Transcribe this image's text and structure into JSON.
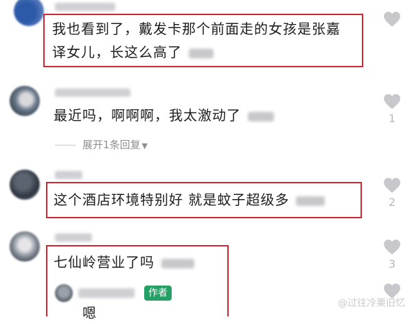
{
  "comments": [
    {
      "text_line1": "我也看到了，戴发卡那个前面走的女孩是张嘉",
      "text_line2": "译女儿，长这么高了",
      "likes": ""
    },
    {
      "text": "最近吗，啊啊啊，我太激动了",
      "likes": "1",
      "expand_label": "展开1条回复"
    },
    {
      "text": "这个酒店环境特别好 就是蚊子超级多",
      "likes": "2"
    },
    {
      "text": "七仙岭营业了吗",
      "likes": "3",
      "reply": {
        "badge": "作者",
        "text": "嗯"
      }
    }
  ],
  "watermark": "@过往冷栗旧忆",
  "colors": {
    "highlight_box": "#d4242f",
    "author_badge": "#25a065",
    "muted": "#8e8e93"
  },
  "icons": [
    "heart-icon",
    "caret-down-icon",
    "author-badge"
  ]
}
